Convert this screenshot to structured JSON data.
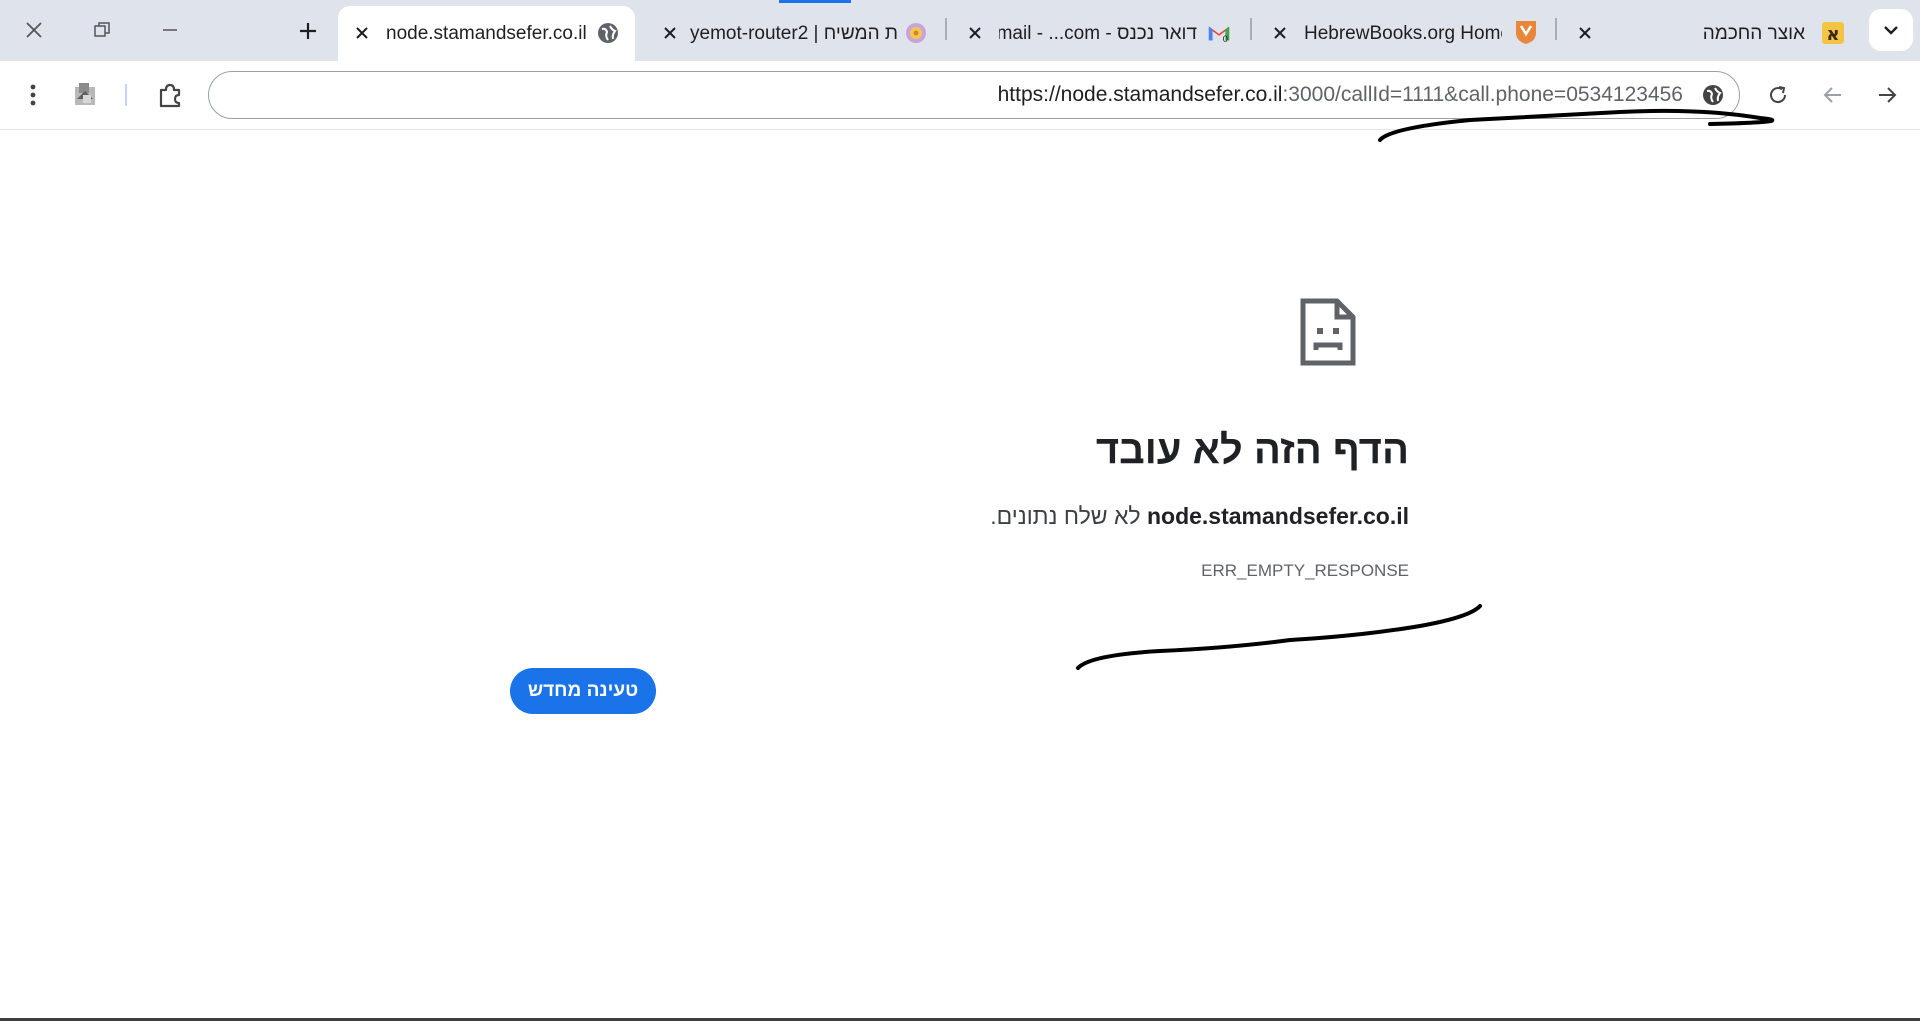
{
  "tabs": [
    {
      "title": "node.stamandsefer.co.il",
      "active": true,
      "favicon": "globe-icon"
    },
    {
      "title": "yemot-router2 | ת המשיח",
      "active": false,
      "favicon": "spinner-icon"
    },
    {
      "title": "דואר נכנס - Gmail - ...com",
      "active": false,
      "favicon": "gmail-icon"
    },
    {
      "title": "HebrewBooks.org Home",
      "active": false,
      "favicon": "hebrewbooks-icon"
    },
    {
      "title": "אוצר החכמה",
      "active": false,
      "favicon": "otzar-icon"
    }
  ],
  "address_bar": {
    "url_main": "https://node.stamandsefer.co.il",
    "url_rest": ":3000/callId=1111&call.phone=0534123456"
  },
  "error_page": {
    "title": "הדף הזה לא עובד",
    "host": "node.stamandsefer.co.il",
    "message_suffix": "לא שלח נתונים.",
    "code": "ERR_EMPTY_RESPONSE",
    "reload_label": "טעינה מחדש"
  },
  "colors": {
    "accent": "#1a73e8",
    "tabstrip_bg": "#dfe3eb"
  }
}
